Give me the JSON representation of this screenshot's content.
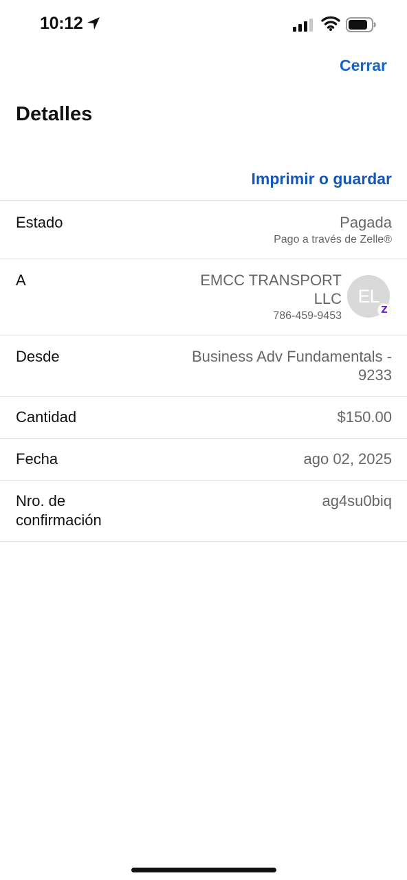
{
  "status_bar": {
    "time": "10:12",
    "icons": [
      "location-arrow-icon",
      "cellular-signal-icon",
      "wifi-icon",
      "battery-icon"
    ]
  },
  "header": {
    "close_label": "Cerrar",
    "title": "Detalles",
    "print_label": "Imprimir o guardar"
  },
  "details": {
    "estado": {
      "label": "Estado",
      "value": "Pagada",
      "sub": "Pago a través de Zelle®"
    },
    "a": {
      "label": "A",
      "name_line1": "EMCC TRANSPORT",
      "name_line2": "LLC",
      "phone": "786-459-9453",
      "avatar_initials": "EL",
      "badge": "Z"
    },
    "desde": {
      "label": "Desde",
      "line1": "Business Adv Fundamentals -",
      "line2": "9233"
    },
    "cantidad": {
      "label": "Cantidad",
      "value": "$150.00"
    },
    "fecha": {
      "label": "Fecha",
      "value": "ago 02, 2025"
    },
    "confirmacion": {
      "label_line1": "Nro. de",
      "label_line2": "confirmación",
      "value": "ag4su0biq"
    }
  },
  "colors": {
    "link": "#1565c8",
    "zelle_purple": "#6d1ed4",
    "secondary_text": "#666666"
  }
}
